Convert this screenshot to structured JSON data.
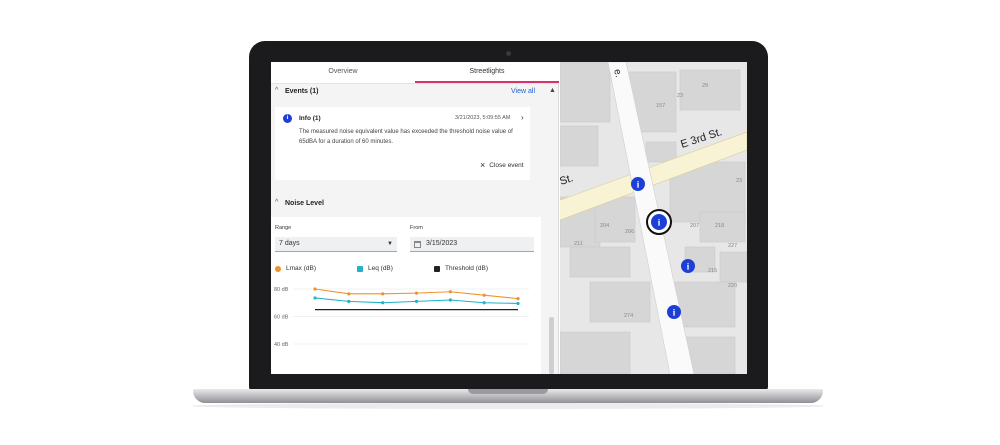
{
  "tabs": [
    {
      "label": "Overview",
      "active": false
    },
    {
      "label": "Streetlights",
      "active": true
    }
  ],
  "events": {
    "title": "Events (1)",
    "view_all": "View all",
    "card": {
      "icon": "info-icon",
      "title": "Info (1)",
      "timestamp": "3/21/2023, 5:09:55 AM",
      "message": "The measured noise equivalent value has exceeded the threshold noise value of 65dBA for a duration of 60 minutes.",
      "close_label": "Close event"
    }
  },
  "noise_level": {
    "title": "Noise Level",
    "range_label": "Range",
    "range_value": "7 days",
    "from_label": "From",
    "from_value": "3/15/2023"
  },
  "map": {
    "street_main": "E 3rd St.",
    "street_partial": "St.",
    "avenue_partial": "e.",
    "building_numbers": [
      "157",
      "23",
      "29",
      "204",
      "206",
      "207",
      "218",
      "274",
      "211",
      "215",
      "220",
      "227",
      "23"
    ]
  },
  "colors": {
    "lmax": "#f0932b",
    "leq": "#21b4c7",
    "threshold": "#222222",
    "tab_accent": "#d6336c",
    "marker": "#1d3fd6",
    "link": "#1f5fd6"
  },
  "chart_data": {
    "type": "line",
    "legend": [
      "Lmax (dB)",
      "Leq (dB)",
      "Threshold (dB)"
    ],
    "y_ticks": [
      "80 dB",
      "60 dB",
      "40 dB"
    ],
    "ylim": [
      40,
      80
    ],
    "x": [
      1,
      2,
      3,
      4,
      5,
      6,
      7
    ],
    "series": [
      {
        "name": "Lmax (dB)",
        "color": "#f0932b",
        "values": [
          80,
          76.5,
          76.5,
          77,
          78,
          75.5,
          73
        ]
      },
      {
        "name": "Leq (dB)",
        "color": "#21b4c7",
        "values": [
          73.5,
          71,
          70,
          71,
          72,
          70,
          69.5
        ]
      },
      {
        "name": "Threshold (dB)",
        "color": "#222222",
        "values": [
          65,
          65,
          65,
          65,
          65,
          65,
          65
        ]
      }
    ]
  }
}
